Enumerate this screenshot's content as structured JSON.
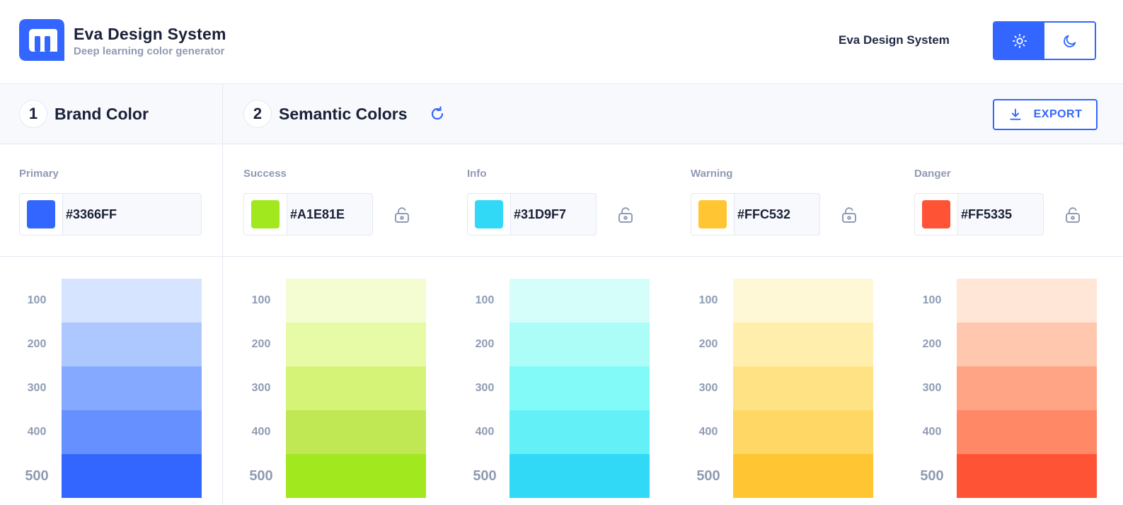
{
  "header": {
    "title": "Eva Design System",
    "subtitle": "Deep learning color generator",
    "nav_link": "Eva Design System",
    "theme_light_icon": "sun-icon",
    "theme_dark_icon": "moon-icon"
  },
  "steps": [
    {
      "number": "1",
      "title": "Brand Color"
    },
    {
      "number": "2",
      "title": "Semantic Colors"
    }
  ],
  "export_label": "EXPORT",
  "colors": [
    {
      "label": "Primary",
      "hex": "#3366FF",
      "color": "#3366ff",
      "lockable": false,
      "shades": [
        {
          "step": "100",
          "color": "#d6e4ff"
        },
        {
          "step": "200",
          "color": "#adc8ff"
        },
        {
          "step": "300",
          "color": "#84a9ff"
        },
        {
          "step": "400",
          "color": "#6690ff"
        },
        {
          "step": "500",
          "color": "#3366ff"
        }
      ]
    },
    {
      "label": "Success",
      "hex": "#A1E81E",
      "color": "#a1e81e",
      "lockable": true,
      "shades": [
        {
          "step": "100",
          "color": "#f4fcd2"
        },
        {
          "step": "200",
          "color": "#e7faa5"
        },
        {
          "step": "300",
          "color": "#d4f377"
        },
        {
          "step": "400",
          "color": "#c0e855"
        },
        {
          "step": "500",
          "color": "#a1e81e"
        }
      ]
    },
    {
      "label": "Info",
      "hex": "#31D9F7",
      "color": "#31d9f7",
      "lockable": true,
      "shades": [
        {
          "step": "100",
          "color": "#d5fefa"
        },
        {
          "step": "200",
          "color": "#acfdf8"
        },
        {
          "step": "300",
          "color": "#82fbf8"
        },
        {
          "step": "400",
          "color": "#63f0f7"
        },
        {
          "step": "500",
          "color": "#31d9f7"
        }
      ]
    },
    {
      "label": "Warning",
      "hex": "#FFC532",
      "color": "#ffc532",
      "lockable": true,
      "shades": [
        {
          "step": "100",
          "color": "#fff8d6"
        },
        {
          "step": "200",
          "color": "#ffeeac"
        },
        {
          "step": "300",
          "color": "#ffe283"
        },
        {
          "step": "400",
          "color": "#ffd765"
        },
        {
          "step": "500",
          "color": "#ffc532"
        }
      ]
    },
    {
      "label": "Danger",
      "hex": "#FF5335",
      "color": "#ff5335",
      "lockable": true,
      "shades": [
        {
          "step": "100",
          "color": "#ffe6d6"
        },
        {
          "step": "200",
          "color": "#ffc8ae"
        },
        {
          "step": "300",
          "color": "#ffa485"
        },
        {
          "step": "400",
          "color": "#ff8867"
        },
        {
          "step": "500",
          "color": "#ff5335"
        }
      ]
    }
  ],
  "theme": {
    "accent": "#3366ff",
    "text": "#1a2138",
    "muted": "#8f9bb3",
    "border": "#e4e9f2",
    "surface": "#f7f9fc"
  }
}
